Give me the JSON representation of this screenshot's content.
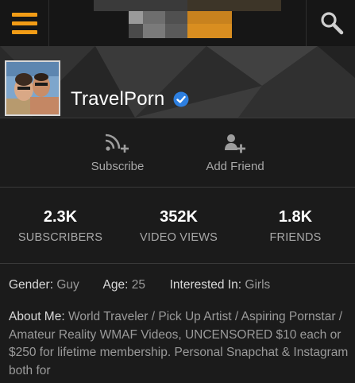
{
  "header": {
    "menu_icon": "hamburger-menu-icon",
    "search_icon": "search-icon",
    "accent_color": "#f29c16"
  },
  "channel": {
    "name": "TravelPorn",
    "verified_icon": "verified-check-icon",
    "verified_color": "#2d7fe0"
  },
  "actions": {
    "subscribe_label": "Subscribe",
    "subscribe_icon": "rss-plus-icon",
    "add_friend_label": "Add Friend",
    "add_friend_icon": "person-plus-icon"
  },
  "stats": [
    {
      "value": "2.3K",
      "caption": "SUBSCRIBERS"
    },
    {
      "value": "352K",
      "caption": "VIDEO VIEWS"
    },
    {
      "value": "1.8K",
      "caption": "FRIENDS"
    }
  ],
  "profile": {
    "gender_label": "Gender:",
    "gender_value": "Guy",
    "age_label": "Age:",
    "age_value": "25",
    "interested_label": "Interested In:",
    "interested_value": "Girls",
    "about_label": "About Me:",
    "about_value": "World Traveler / Pick Up Artist / Aspiring Pornstar / Amateur Reality WMAF Videos, UNCENSORED $10 each or $250 for lifetime membership. Personal Snapchat & Instagram both for"
  }
}
